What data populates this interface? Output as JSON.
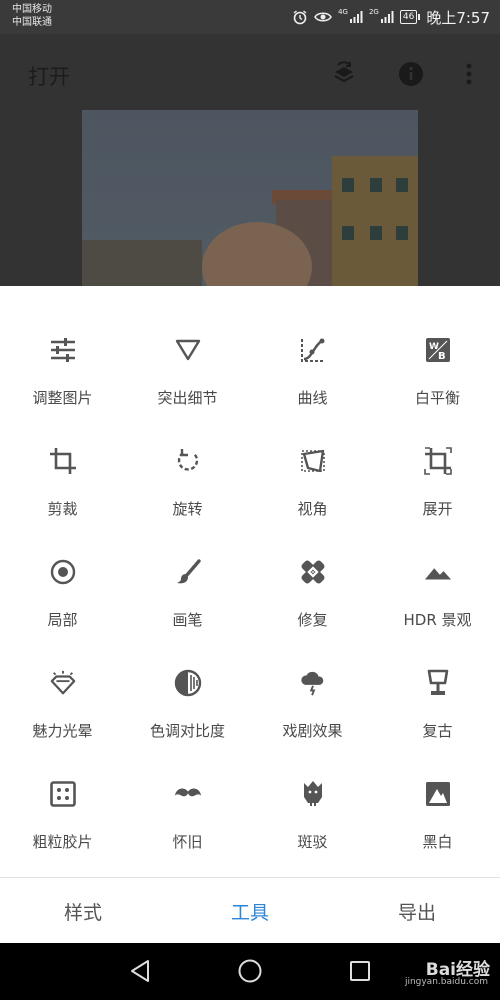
{
  "status_bar": {
    "carrier_1": "中国移动",
    "carrier_2": "中国联通",
    "signal_1_tag": "4G",
    "signal_2_tag": "2G",
    "battery": "46",
    "time": "晚上7:57"
  },
  "app_bar": {
    "title": "打开",
    "icons": [
      "layers-icon",
      "info-icon",
      "more-vert-icon"
    ]
  },
  "tools": [
    {
      "label": "调整图片",
      "icon": "sliders-icon"
    },
    {
      "label": "突出细节",
      "icon": "triangle-down-icon"
    },
    {
      "label": "曲线",
      "icon": "curves-icon"
    },
    {
      "label": "白平衡",
      "icon": "white-balance-icon"
    },
    {
      "label": "剪裁",
      "icon": "crop-icon"
    },
    {
      "label": "旋转",
      "icon": "rotate-icon"
    },
    {
      "label": "视角",
      "icon": "perspective-icon"
    },
    {
      "label": "展开",
      "icon": "expand-icon"
    },
    {
      "label": "局部",
      "icon": "target-icon"
    },
    {
      "label": "画笔",
      "icon": "brush-icon"
    },
    {
      "label": "修复",
      "icon": "bandage-icon"
    },
    {
      "label": "HDR 景观",
      "icon": "mountains-icon"
    },
    {
      "label": "魅力光晕",
      "icon": "diamond-glow-icon"
    },
    {
      "label": "色调对比度",
      "icon": "tonal-contrast-icon"
    },
    {
      "label": "戏剧效果",
      "icon": "storm-cloud-icon"
    },
    {
      "label": "复古",
      "icon": "lamp-icon"
    },
    {
      "label": "粗粒胶片",
      "icon": "dice-icon"
    },
    {
      "label": "怀旧",
      "icon": "mustache-icon"
    },
    {
      "label": "斑驳",
      "icon": "grunge-icon"
    },
    {
      "label": "黑白",
      "icon": "black-white-icon"
    }
  ],
  "tabs": [
    {
      "label": "样式",
      "active": false
    },
    {
      "label": "工具",
      "active": true
    },
    {
      "label": "导出",
      "active": false
    }
  ],
  "colors": {
    "accent": "#2f86d6",
    "icon": "#555555"
  },
  "watermark": {
    "brand": "Bai经验",
    "url": "jingyan.baidu.com"
  }
}
